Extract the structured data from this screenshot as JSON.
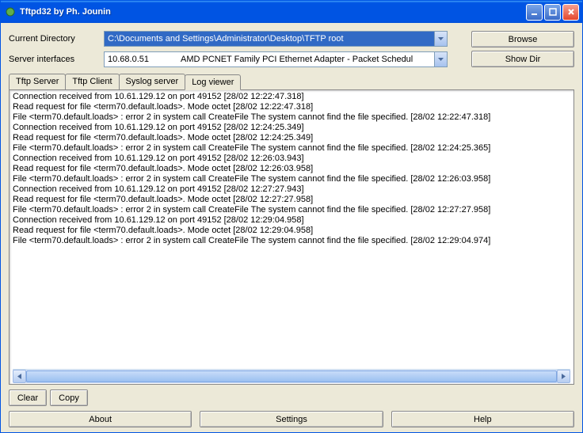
{
  "window": {
    "title": "Tftpd32 by Ph. Jounin"
  },
  "labels": {
    "current_directory": "Current Directory",
    "server_interfaces": "Server interfaces"
  },
  "fields": {
    "directory": "C:\\Documents and Settings\\Administrator\\Desktop\\TFTP root",
    "interface_ip": "10.68.0.51",
    "interface_desc": "AMD PCNET Family PCI Ethernet Adapter - Packet Schedul"
  },
  "buttons": {
    "browse": "Browse",
    "show_dir": "Show Dir",
    "clear": "Clear",
    "copy": "Copy",
    "about": "About",
    "settings": "Settings",
    "help": "Help"
  },
  "tabs": [
    {
      "id": "tftp-server",
      "label": "Tftp Server"
    },
    {
      "id": "tftp-client",
      "label": "Tftp Client"
    },
    {
      "id": "syslog-server",
      "label": "Syslog server"
    },
    {
      "id": "log-viewer",
      "label": "Log viewer"
    }
  ],
  "active_tab": "log-viewer",
  "log": [
    "Connection received from 10.61.129.12 on port 49152 [28/02 12:22:47.318]",
    "Read request for file <term70.default.loads>. Mode octet [28/02 12:22:47.318]",
    "File <term70.default.loads> : error 2 in system call CreateFile The system cannot find the file specified. [28/02 12:22:47.318]",
    "Connection received from 10.61.129.12 on port 49152 [28/02 12:24:25.349]",
    "Read request for file <term70.default.loads>. Mode octet [28/02 12:24:25.349]",
    "File <term70.default.loads> : error 2 in system call CreateFile The system cannot find the file specified. [28/02 12:24:25.365]",
    "Connection received from 10.61.129.12 on port 49152 [28/02 12:26:03.943]",
    "Read request for file <term70.default.loads>. Mode octet [28/02 12:26:03.958]",
    "File <term70.default.loads> : error 2 in system call CreateFile The system cannot find the file specified. [28/02 12:26:03.958]",
    "Connection received from 10.61.129.12 on port 49152 [28/02 12:27:27.943]",
    "Read request for file <term70.default.loads>. Mode octet [28/02 12:27:27.958]",
    "File <term70.default.loads> : error 2 in system call CreateFile The system cannot find the file specified. [28/02 12:27:27.958]",
    "Connection received from 10.61.129.12 on port 49152 [28/02 12:29:04.958]",
    "Read request for file <term70.default.loads>. Mode octet [28/02 12:29:04.958]",
    "File <term70.default.loads> : error 2 in system call CreateFile The system cannot find the file specified. [28/02 12:29:04.974]"
  ]
}
